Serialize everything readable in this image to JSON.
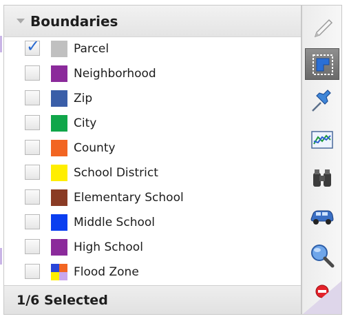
{
  "panel": {
    "title": "Boundaries",
    "footer": "1/6 Selected",
    "items": [
      {
        "label": "Parcel",
        "checked": true,
        "color": "#c0c0c0"
      },
      {
        "label": "Neighborhood",
        "checked": false,
        "color": "#8b2a9b"
      },
      {
        "label": "Zip",
        "checked": false,
        "color": "#3a5ea8"
      },
      {
        "label": "City",
        "checked": false,
        "color": "#10a64a"
      },
      {
        "label": "County",
        "checked": false,
        "color": "#f26522"
      },
      {
        "label": "School District",
        "checked": false,
        "color": "#ffee00"
      },
      {
        "label": "Elementary School",
        "checked": false,
        "color": "#8a3b24"
      },
      {
        "label": "Middle School",
        "checked": false,
        "color": "#0a3ef0"
      },
      {
        "label": "High School",
        "checked": false,
        "color": "#8b2a9b"
      },
      {
        "label": "Flood Zone",
        "checked": false,
        "colors": [
          "#2b46d8",
          "#f26522",
          "#ffee00",
          "#c9a6ec"
        ]
      }
    ]
  },
  "toolbar": {
    "tools": [
      "pencil-icon",
      "boundary-select-icon",
      "pushpin-icon",
      "chart-icon",
      "binoculars-icon",
      "car-icon",
      "magnifier-icon",
      "remove-icon"
    ],
    "active": "boundary-select-icon"
  }
}
